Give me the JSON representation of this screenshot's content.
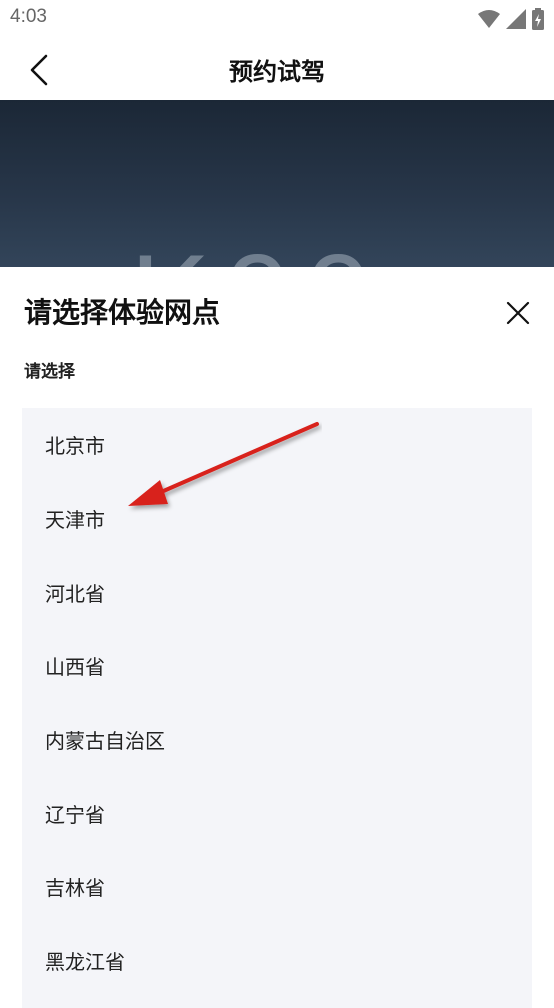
{
  "status": {
    "time": "4:03"
  },
  "nav": {
    "title": "预约试驾"
  },
  "banner": {
    "logo_text": "K00"
  },
  "sheet": {
    "title": "请选择体验网点",
    "subtitle": "请选择",
    "items": [
      {
        "label": "北京市"
      },
      {
        "label": "天津市"
      },
      {
        "label": "河北省"
      },
      {
        "label": "山西省"
      },
      {
        "label": "内蒙古自治区"
      },
      {
        "label": "辽宁省"
      },
      {
        "label": "吉林省"
      },
      {
        "label": "黑龙江省"
      }
    ]
  },
  "colors": {
    "list_bg": "#f4f5f9",
    "arrow": "#d8201c",
    "banner": "#1b2736"
  },
  "icons": [
    "wifi-icon",
    "signal-icon",
    "battery-icon",
    "back-arrow-icon",
    "close-icon",
    "annotation-arrow"
  ]
}
